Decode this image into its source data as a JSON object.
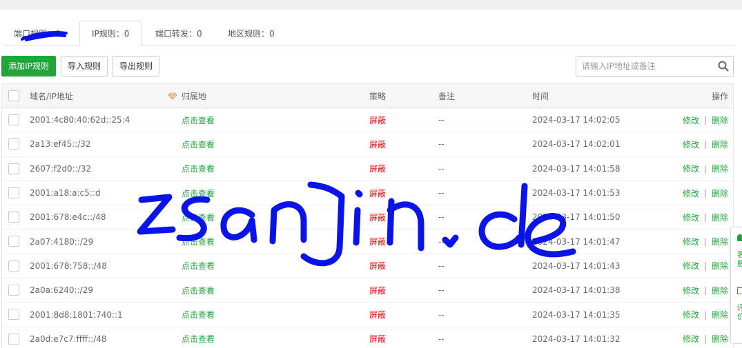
{
  "tabs": [
    {
      "label": "端口规则：0",
      "active": false
    },
    {
      "label": "IP规则：0",
      "active": true
    },
    {
      "label": "端口转发：0",
      "active": false
    },
    {
      "label": "地区规则：0",
      "active": false
    }
  ],
  "toolbar": {
    "add_label": "添加IP规则",
    "import_label": "导入规则",
    "export_label": "导出规则"
  },
  "search": {
    "placeholder": "请输入IP地址或备注",
    "icon": "search-icon"
  },
  "table": {
    "headers": {
      "ip": "域名/IP地址",
      "location": "归属地",
      "policy": "策略",
      "note": "备注",
      "time": "时间",
      "ops": "操作"
    },
    "edit_label": "修改",
    "sep": "|",
    "delete_label": "删除",
    "rows": [
      {
        "ip": "2001:4c80:40:62d::25:4",
        "location": "点击查看",
        "policy": "屏蔽",
        "note": "--",
        "time": "2024-03-17 14:02:05"
      },
      {
        "ip": "2a13:ef45::/32",
        "location": "点击查看",
        "policy": "屏蔽",
        "note": "--",
        "time": "2024-03-17 14:02:01"
      },
      {
        "ip": "2607:f2d0::/32",
        "location": "点击查看",
        "policy": "屏蔽",
        "note": "--",
        "time": "2024-03-17 14:01:58"
      },
      {
        "ip": "2001:a18:a:c5::d",
        "location": "点击查看",
        "policy": "屏蔽",
        "note": "--",
        "time": "2024-03-17 14:01:53"
      },
      {
        "ip": "2001:678:e4c::/48",
        "location": "点击查看",
        "policy": "屏蔽",
        "note": "--",
        "time": "2024-03-17 14:01:50"
      },
      {
        "ip": "2a07:4180::/29",
        "location": "点击查看",
        "policy": "屏蔽",
        "note": "--",
        "time": "2024-03-17 14:01:47"
      },
      {
        "ip": "2001:678:758::/48",
        "location": "点击查看",
        "policy": "屏蔽",
        "note": "--",
        "time": "2024-03-17 14:01:43"
      },
      {
        "ip": "2a0a:6240::/29",
        "location": "点击查看",
        "policy": "屏蔽",
        "note": "--",
        "time": "2024-03-17 14:01:38"
      },
      {
        "ip": "2001:8d8:1801:740::1",
        "location": "点击查看",
        "policy": "屏蔽",
        "note": "--",
        "time": "2024-03-17 14:01:35"
      },
      {
        "ip": "2a0d:e7c7:ffff::/48",
        "location": "点击查看",
        "policy": "屏蔽",
        "note": "--",
        "time": "2024-03-17 14:01:32"
      }
    ]
  },
  "side_float": {
    "text_top": "客服",
    "text_bottom": "评价"
  },
  "watermark": {
    "text": "zsanjin.de",
    "color": "#0a14e6"
  },
  "colors": {
    "accent": "#20a53a",
    "danger": "#ef0808"
  }
}
